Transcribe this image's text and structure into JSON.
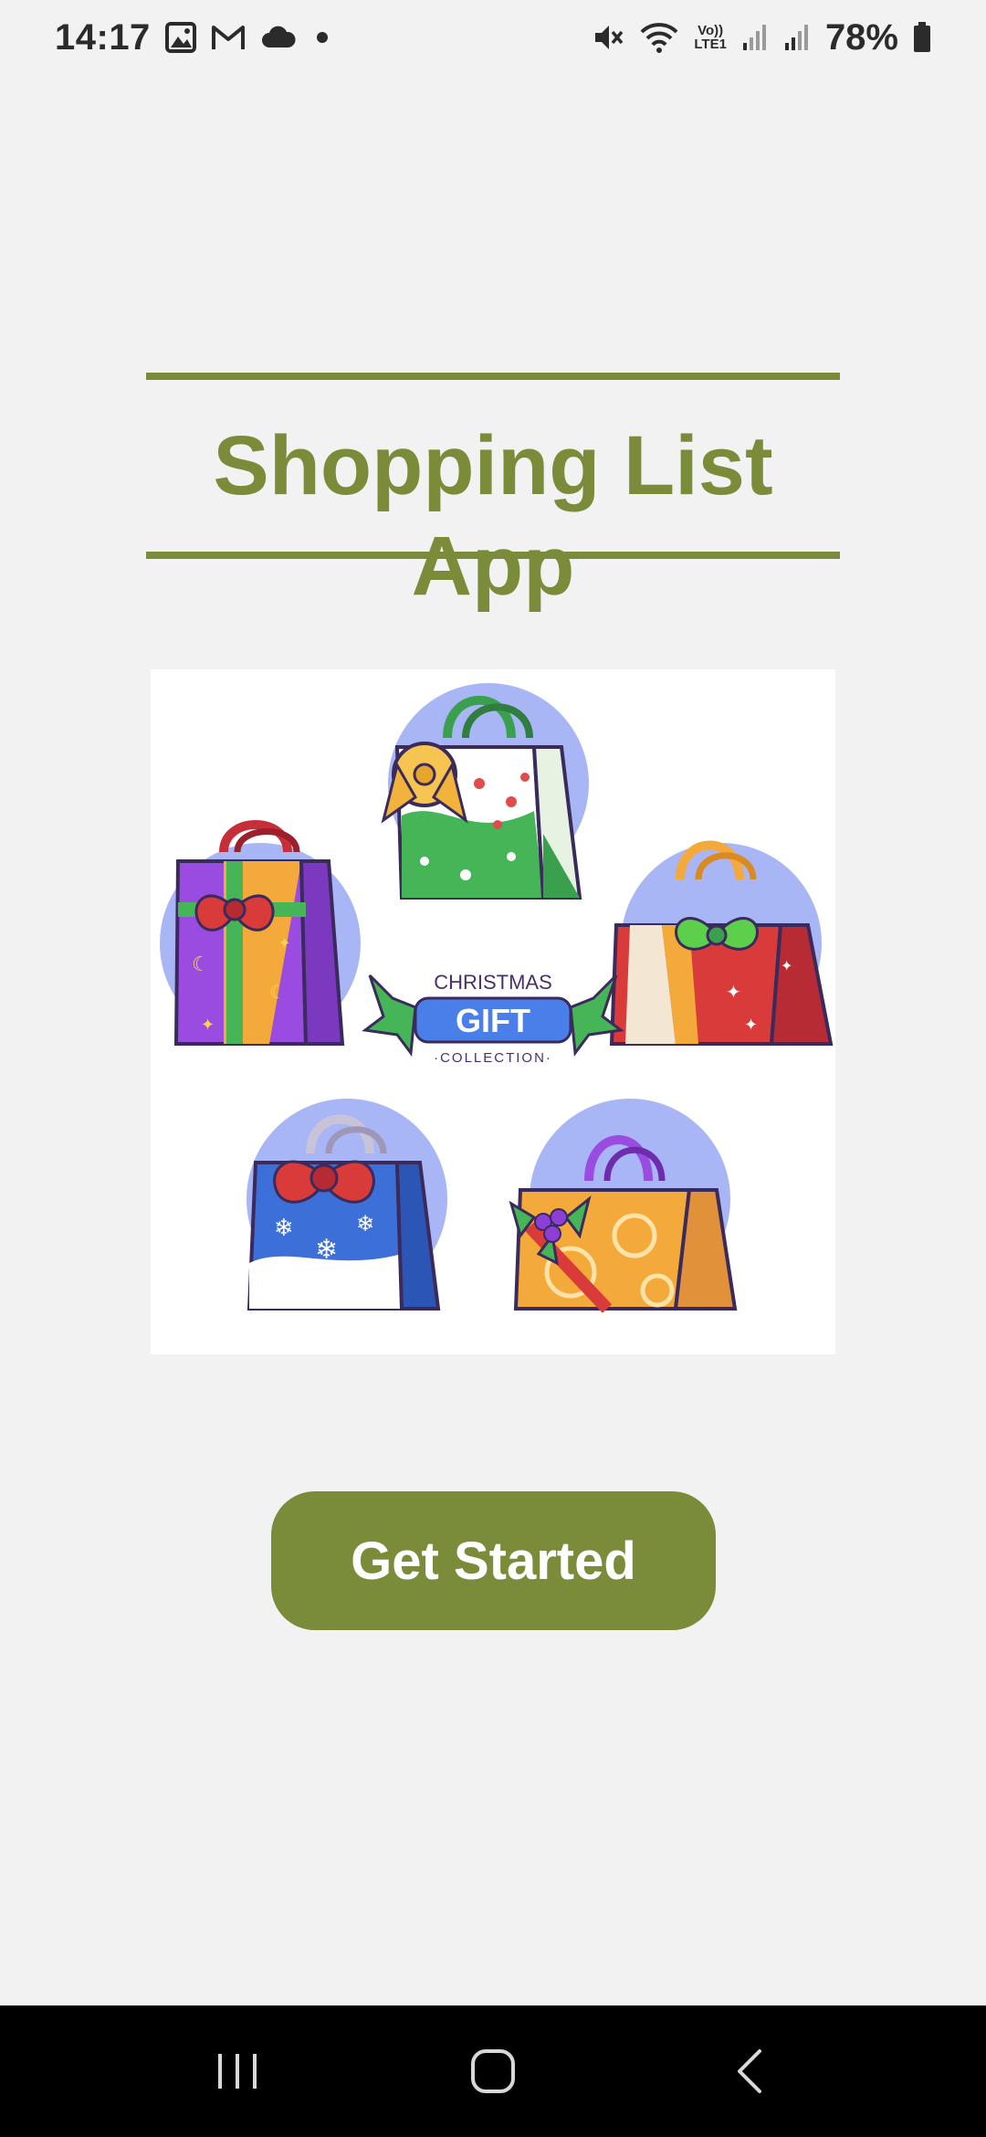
{
  "status_bar": {
    "time": "14:17",
    "battery_percent": "78%",
    "left_icons": [
      "gallery-icon",
      "gmail-icon",
      "cloud-icon",
      "dot-icon"
    ],
    "right_icons": [
      "mute-icon",
      "wifi-icon",
      "volte-lte-icon",
      "signal-icon",
      "signal-icon",
      "battery-icon"
    ],
    "volte_label_1": "Vo))",
    "volte_label_2": "LTE1"
  },
  "header": {
    "title": "Shopping List App"
  },
  "illustration": {
    "banner_top": "CHRISTMAS",
    "banner_main": "GIFT",
    "banner_bottom": "·COLLECTION·"
  },
  "actions": {
    "get_started_label": "Get Started"
  },
  "nav_bar": {
    "icons": [
      "recent-apps-icon",
      "home-icon",
      "back-icon"
    ]
  },
  "colors": {
    "accent": "#7a8c3a",
    "background": "#f2f2f2",
    "nav_background": "#000000"
  }
}
